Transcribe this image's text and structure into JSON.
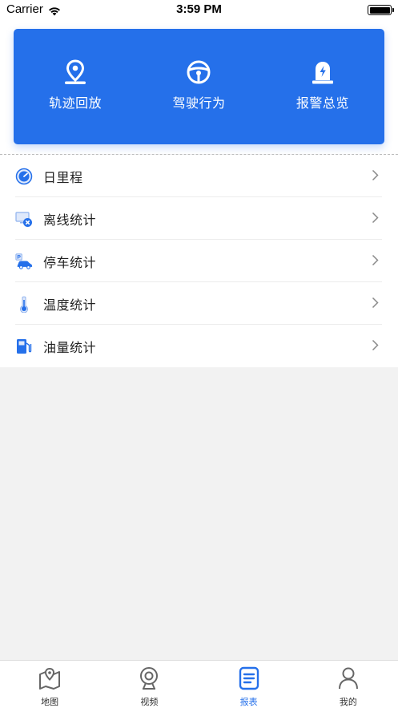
{
  "status_bar": {
    "carrier": "Carrier",
    "time": "3:59 PM"
  },
  "quick_actions": [
    {
      "label": "轨迹回放",
      "icon": "location-pin-icon"
    },
    {
      "label": "驾驶行为",
      "icon": "steering-wheel-icon"
    },
    {
      "label": "报警总览",
      "icon": "alarm-light-icon"
    }
  ],
  "menu": [
    {
      "label": "日里程",
      "icon": "speedometer-icon"
    },
    {
      "label": "离线统计",
      "icon": "offline-monitor-icon"
    },
    {
      "label": "停车统计",
      "icon": "parking-car-icon"
    },
    {
      "label": "温度统计",
      "icon": "thermometer-icon"
    },
    {
      "label": "油量统计",
      "icon": "fuel-pump-icon"
    }
  ],
  "tabs": [
    {
      "label": "地图",
      "icon": "map-icon"
    },
    {
      "label": "视频",
      "icon": "camera-icon"
    },
    {
      "label": "报表",
      "icon": "report-icon",
      "active": true
    },
    {
      "label": "我的",
      "icon": "profile-icon"
    }
  ],
  "colors": {
    "accent": "#2570ea",
    "background": "#f2f2f2",
    "tab_inactive": "#333333"
  }
}
